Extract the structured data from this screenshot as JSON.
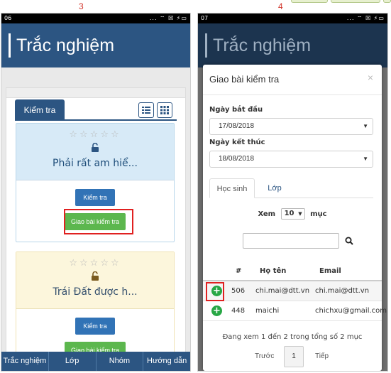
{
  "step_labels": [
    "3",
    "4"
  ],
  "left": {
    "status": {
      "time": "06",
      "icons": "... ⌔ ☒ ⚡▭"
    },
    "app_title": "Trắc nghiệm",
    "tab_label": "Kiểm tra",
    "cards": [
      {
        "title": "Phải rất am hiể...",
        "stars": "☆☆☆☆☆",
        "button1": "Kiểm tra",
        "button2": "Giao bài kiểm tra"
      },
      {
        "title": "Trái Đất được h...",
        "stars": "☆☆☆☆☆",
        "button1": "Kiểm tra",
        "button2": "Giao bài kiểm tra"
      }
    ],
    "bottom_nav": [
      "Trắc nghiệm",
      "Lớp",
      "Nhóm",
      "Hướng dẫn"
    ]
  },
  "right": {
    "status": {
      "time": "07",
      "icons": "... ⌔ ☒ ⚡▭"
    },
    "app_title": "Trắc nghiệm",
    "modal": {
      "title": "Giao bài kiểm tra",
      "close": "×",
      "start_label": "Ngày bắt đầu",
      "start_value": "17/08/2018",
      "end_label": "Ngày kết thúc",
      "end_value": "18/08/2018",
      "tabs": [
        "Học sinh",
        "Lớp"
      ],
      "show_label": "Xem",
      "show_value": "10",
      "show_suffix": "mục",
      "columns": [
        "#",
        "Họ tên",
        "Email"
      ],
      "rows": [
        {
          "id": "506",
          "name": "chi.mai@dtt.vn",
          "email": "chi.mai@dtt.vn"
        },
        {
          "id": "448",
          "name": "maichi",
          "email": "chichxu@gmail.com"
        }
      ],
      "info": "Đang xem 1 đến 2 trong tổng số 2 mục",
      "prev": "Trước",
      "page": "1",
      "next": "Tiếp"
    }
  },
  "colors": {
    "primary": "#2c5582",
    "button_blue": "#3173b6",
    "button_green": "#5cb74e",
    "highlight": "#e02020",
    "add": "#28a745"
  }
}
